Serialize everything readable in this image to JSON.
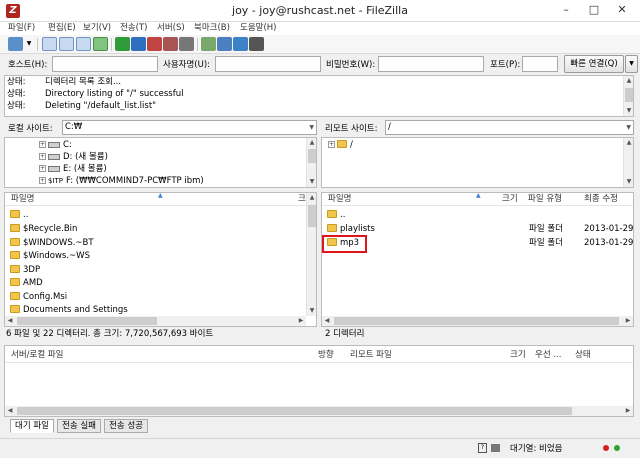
{
  "window": {
    "title": "joy - joy@rushcast.net - FileZilla",
    "minimize": "–",
    "maximize": "□",
    "close": "✕"
  },
  "menu": [
    "파일(F)",
    "편집(E)",
    "보기(V)",
    "전송(T)",
    "서버(S)",
    "북마크(B)",
    "도움말(H)"
  ],
  "toolbar": {
    "icons": [
      "site-manager-icon",
      "dropdown-arrow-icon",
      "message-log-toggle-icon",
      "local-tree-toggle-icon",
      "remote-tree-toggle-icon",
      "transfer-queue-toggle-icon",
      "refresh-icon",
      "process-queue-icon",
      "cancel-icon",
      "disconnect-icon",
      "reconnect-icon",
      "filter-icon",
      "compare-icon",
      "sync-browse-icon",
      "search-icon"
    ]
  },
  "quickconnect": {
    "host_label": "호스트(H):",
    "user_label": "사용자명(U):",
    "pass_label": "비밀번호(W):",
    "port_label": "포트(P):",
    "host_value": "",
    "user_value": "",
    "pass_value": "",
    "port_value": "",
    "connect_label": "빠른 연결(Q)",
    "dropdown": "▼"
  },
  "log": [
    {
      "label": "상태:",
      "message": "디렉터리 목록 조회..."
    },
    {
      "label": "상태:",
      "message": "Directory listing of \"/\" successful"
    },
    {
      "label": "상태:",
      "message": "Deleting \"/default_list.list\""
    }
  ],
  "local": {
    "site_label": "로컬 사이트:",
    "path": "C:₩",
    "tree": [
      {
        "label": "C:",
        "icon": "drive-icon"
      },
      {
        "label": "D: (새 볼륨)",
        "icon": "drive-icon"
      },
      {
        "label": "E: (새 볼륨)",
        "icon": "drive-icon"
      },
      {
        "label": "F: (₩₩COMMIND7-PC₩FTP ibm)",
        "icon": "network-drive-icon",
        "prefix": "$ITP"
      }
    ],
    "columns": {
      "name": "파일명",
      "size": "크"
    },
    "files": [
      "..",
      "$Recycle.Bin",
      "$WINDOWS.~BT",
      "$Windows.~WS",
      "3DP",
      "AMD",
      "Config.Msi",
      "Documents and Settings"
    ],
    "status": "6 파일 및 22 디렉터리. 총 크기: 7,720,567,693 바이트"
  },
  "remote": {
    "site_label": "리모트 사이트:",
    "path": "/",
    "tree": [
      {
        "label": "/",
        "icon": "folder-icon"
      }
    ],
    "columns": {
      "name": "파일명",
      "size": "크기",
      "type": "파일 유형",
      "modified": "최종 수정"
    },
    "files": [
      {
        "name": "..",
        "type": "",
        "modified": ""
      },
      {
        "name": "playlists",
        "type": "파일 폴더",
        "modified": "2013-01-29"
      },
      {
        "name": "mp3",
        "type": "파일 폴더",
        "modified": "2013-01-29"
      }
    ],
    "status": "2 디렉터리"
  },
  "queue": {
    "columns": {
      "server_file": "서버/로컬 파일",
      "direction": "방향",
      "remote_file": "리모트 파일",
      "size": "크기",
      "priority": "우선 ...",
      "status": "상태"
    },
    "tabs": [
      "대기 파일",
      "전송 실패",
      "전송 성공"
    ]
  },
  "statusbar": {
    "queue_text": "대기열: 비었음",
    "encryption_label": "?"
  },
  "colors": {
    "highlight_border": "#e0151b",
    "folder": "#f2c54c",
    "led_red": "#d22020",
    "led_green": "#2ea12e"
  }
}
